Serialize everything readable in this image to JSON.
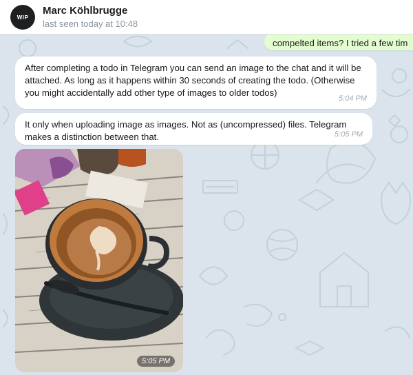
{
  "contact": {
    "avatar_text": "WIP",
    "name": "Marc Köhlbrugge",
    "status": "last seen today at 10:48"
  },
  "messages": [
    {
      "direction": "outgoing",
      "text": "compelted items? I tried a few tim"
    },
    {
      "direction": "incoming",
      "text": "After completing a todo in Telegram you can send an image to the chat and it will be attached. As long as it happens within 30 seconds of creating the todo. (Otherwise you might accidentally add other type of images to older todos)",
      "time": "5:04 PM"
    },
    {
      "direction": "incoming",
      "text": "It only when uploading image as images. Not as (uncompressed) files. Telegram makes a distinction between that.",
      "time": "5:05 PM"
    },
    {
      "direction": "incoming",
      "type": "photo",
      "time": "5:05 PM"
    }
  ],
  "colors": {
    "chat_background": "#dbe4ec",
    "incoming_bubble": "#ffffff",
    "outgoing_bubble": "#e3fdd0",
    "timestamp": "#a2aab2"
  }
}
